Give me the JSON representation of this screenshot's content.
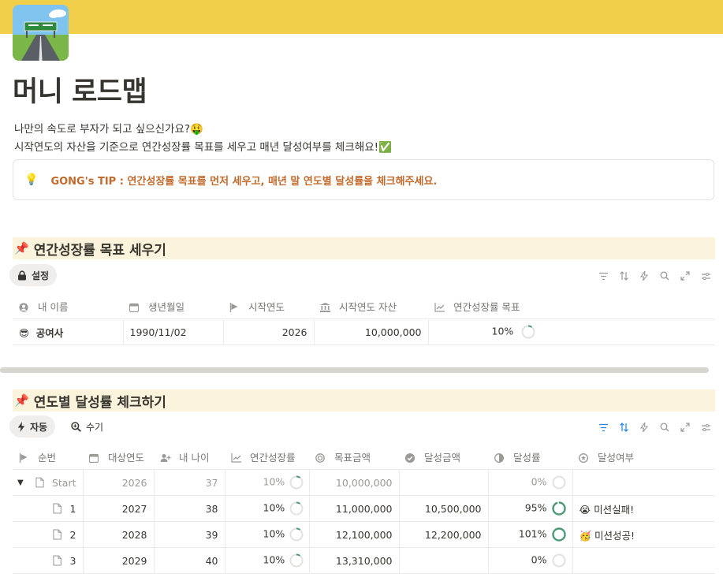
{
  "page": {
    "title": "머니 로드맵",
    "description_line1": "나만의 속도로 부자가 되고 싶으신가요?🤑",
    "description_line2": "시작연도의 자산을 기준으로 연간성장률 목표를 세우고 매년 달성여부를 체크해요!✅",
    "callout_icon": "💡",
    "callout_text": "GONG's TIP : 연간성장률 목표를 먼저 세우고, 매년 말 연도별 달성률을 체크해주세요."
  },
  "colors": {
    "cover": "#f2cf4a",
    "section_bg": "#fbf3db",
    "callout_text": "#c26a2c",
    "ring_green": "#4e9a76",
    "accent_blue": "#2383e2"
  },
  "section1": {
    "pin": "📌",
    "heading": "연간성장률 목표 세우기",
    "view_tab": "설정",
    "view_tab_icon": "lock-icon",
    "columns": [
      "내 이름",
      "생년월일",
      "시작연도",
      "시작연도 자산",
      "연간성장률 목표"
    ],
    "row": {
      "emoji": "😎",
      "name": "공여사",
      "birth": "1990/11/02",
      "start_year": "2026",
      "start_asset": "10,000,000",
      "growth_target": "10%",
      "growth_target_value": 0.1
    }
  },
  "section2": {
    "pin": "📌",
    "heading": "연도별 달성률 체크하기",
    "tabs": [
      "자동",
      "수기"
    ],
    "columns": [
      "순번",
      "대상연도",
      "내 나이",
      "연간성장률",
      "목표금액",
      "달성금액",
      "달성률",
      "달성여부"
    ],
    "rows": [
      {
        "name": "Start",
        "year": "2026",
        "age": "37",
        "growth": "10%",
        "growth_value": 0.1,
        "target": "10,000,000",
        "achieved": "",
        "rate": "0%",
        "rate_value": 0,
        "status": ""
      },
      {
        "name": "1",
        "year": "2027",
        "age": "38",
        "growth": "10%",
        "growth_value": 0.1,
        "target": "11,000,000",
        "achieved": "10,500,000",
        "rate": "95%",
        "rate_value": 0.95,
        "status": "😭 미션실패!"
      },
      {
        "name": "2",
        "year": "2028",
        "age": "39",
        "growth": "10%",
        "growth_value": 0.1,
        "target": "12,100,000",
        "achieved": "12,200,000",
        "rate": "101%",
        "rate_value": 1.0,
        "status": "🥳 미션성공!"
      },
      {
        "name": "3",
        "year": "2029",
        "age": "40",
        "growth": "10%",
        "growth_value": 0.1,
        "target": "13,310,000",
        "achieved": "",
        "rate": "0%",
        "rate_value": 0,
        "status": ""
      }
    ]
  }
}
